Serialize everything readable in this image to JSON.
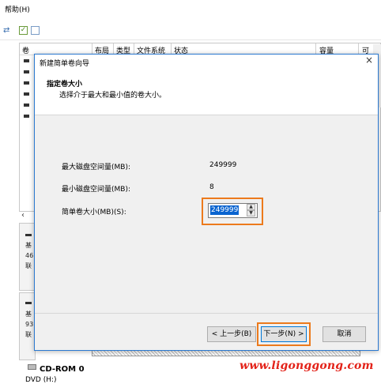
{
  "menu": {
    "help": "帮助(H)"
  },
  "volume_table": {
    "columns": [
      "卷",
      "布局",
      "类型",
      "文件系统",
      "状态",
      "容量",
      "可"
    ]
  },
  "disks": [
    {
      "label_lines": [
        "基",
        "46",
        "联"
      ]
    },
    {
      "label_lines": [
        "基",
        "93",
        "联"
      ]
    }
  ],
  "cdrom": {
    "name": "CD-ROM 0",
    "sub": "DVD (H:)"
  },
  "dialog": {
    "title": "新建简单卷向导",
    "close": "×",
    "step_title": "指定卷大小",
    "step_desc": "选择介于最大和最小值的卷大小。",
    "fields": {
      "max_label": "最大磁盘空间量(MB):",
      "max_value": "249999",
      "min_label": "最小磁盘空间量(MB):",
      "min_value": "8",
      "size_label": "简单卷大小(MB)(S):",
      "size_value": "249999"
    },
    "buttons": {
      "back": "< 上一步(B)",
      "next": "下一步(N) >",
      "cancel": "取消"
    }
  },
  "watermark": "www.ligonggong.com",
  "colors": {
    "highlight": "#ec7a1c",
    "selection": "#0a64d0",
    "watermark": "#e32219"
  }
}
